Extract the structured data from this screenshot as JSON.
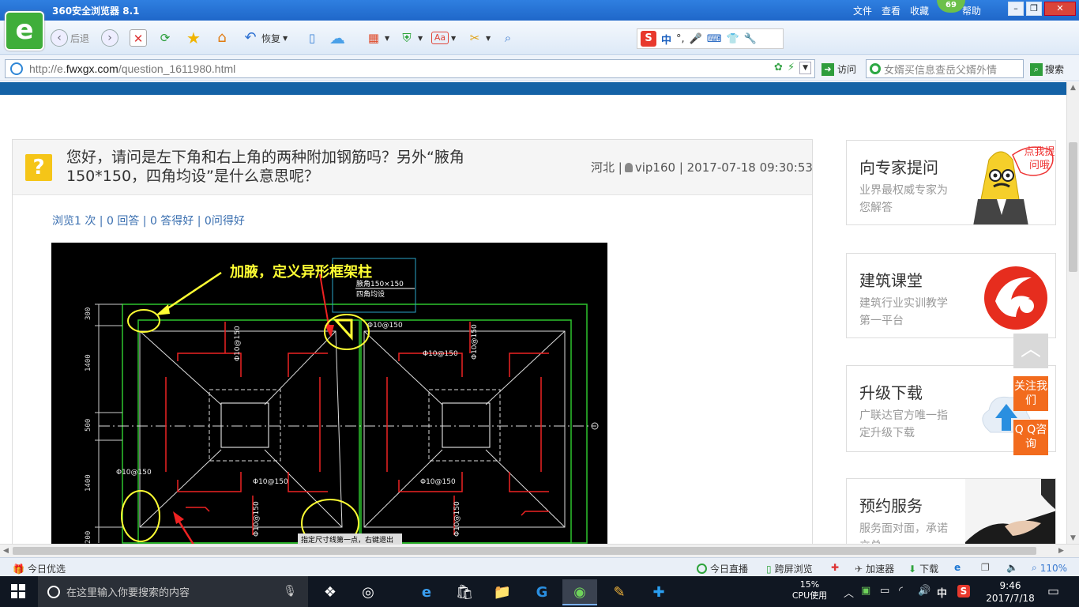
{
  "browser": {
    "title": "360安全浏览器 8.1",
    "menu": [
      "文件",
      "查看",
      "收藏",
      "帮助"
    ],
    "badge": "69",
    "logo_letter": "e",
    "toolbar": {
      "back": "后退",
      "restore": "恢复"
    },
    "url_prefix": "http://e.",
    "url_domain": "fwxgx.com",
    "url_path": "/question_1611980.html",
    "visit": "访问",
    "search_placeholder": "女婿买信息查岳父婿外情",
    "search": "搜索"
  },
  "ime": {
    "logo": "S",
    "mode": "中"
  },
  "question": {
    "title": "您好，请问是左下角和右上角的两种附加钢筋吗？另外“腋角150*150，四角均设”是什么意思呢？",
    "region": "河北",
    "user": "vip160",
    "time": "2017-07-18 09:30:53",
    "stats": "浏览1 次 | 0 回答 | 0 答得好 | 0问得好"
  },
  "drawing": {
    "annotation": "加腋，定义异形框架柱",
    "label_box_line1": "腋角150×150",
    "label_box_line2": "四角均设",
    "rebar_label": "Φ10@150",
    "dims": [
      "300",
      "1400",
      "500",
      "1400",
      "200"
    ],
    "status_text": "指定尺寸线第一点，右键退出"
  },
  "sidebar": {
    "cards": [
      {
        "title": "向专家提问",
        "desc": "业界最权威专家为您解答",
        "bubble": "点我提问哦"
      },
      {
        "title": "建筑课堂",
        "desc": "建筑行业实训教学第一平台"
      },
      {
        "title": "升级下载",
        "desc": "广联达官方唯一指定升级下载"
      },
      {
        "title": "预约服务",
        "desc": "服务面对面，承诺立兑"
      }
    ],
    "follow": "关注我们",
    "qq": "Q Q咨询"
  },
  "statusbar": {
    "today_pick": "今日优选",
    "live": "今日直播",
    "cross_screen": "跨屏浏览",
    "accelerator": "加速器",
    "download": "下载",
    "zoom": "110%"
  },
  "taskbar": {
    "search_placeholder": "在这里输入你要搜索的内容",
    "cpu_percent": "15%",
    "cpu_label": "CPU使用",
    "ime": "中",
    "time": "9:46",
    "date": "2017/7/18"
  },
  "colors": {
    "titlebar": "#1f67c9",
    "page_strip": "#1462a6",
    "float_orange": "#f26b1d",
    "annotation_yellow": "#ffff33"
  }
}
